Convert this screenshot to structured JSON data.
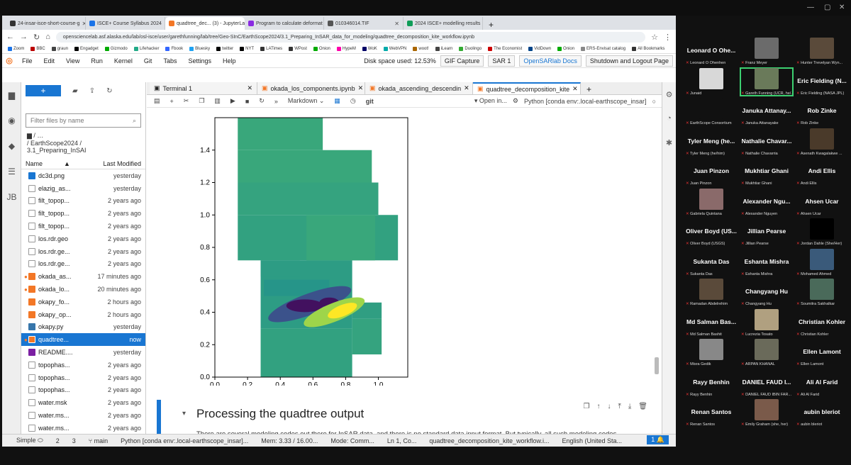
{
  "browser": {
    "tabs": [
      {
        "label": "24-insar-isce-short-course-g",
        "color": "#333"
      },
      {
        "label": "ISCE+ Course Syllabus 2024",
        "color": "#1a73e8"
      },
      {
        "label": "quadtree_dec... (3) - JupyterLab",
        "color": "#f37726",
        "active": true
      },
      {
        "label": "Program to calculate deformat",
        "color": "#8a2be2"
      },
      {
        "label": "010346014.TIF",
        "color": "#555"
      },
      {
        "label": "2024 ISCE+ modelling results",
        "color": "#0f9d58"
      }
    ],
    "url": "opensciencelab.asf.alaska.edu/lab/osl-isce/user/garethfunning/lab/tree/Geo-SInC/EarthScope2024/3.1_Preparing_InSAR_data_for_modeling/quadtree_decomposition_kite_workflow.ipynb",
    "bookmarks": [
      "Zoom",
      "BBC",
      "graun",
      "Engadget",
      "Gizmodo",
      "Lifehacker",
      "Fbook",
      "Bluesky",
      "twitter",
      "NYT",
      "LATimes",
      "WPost",
      "Onion",
      "HypeM",
      "WoK",
      "WebVPN",
      "woot!",
      "iLearn",
      "Duolingo",
      "The Economist",
      "VidDown",
      "Onion",
      "ERS-Envisat catalog",
      "All Bookmarks"
    ]
  },
  "jupyter": {
    "menus": [
      "File",
      "Edit",
      "View",
      "Run",
      "Kernel",
      "Git",
      "Tabs",
      "Settings",
      "Help"
    ],
    "disk_space": "Disk space used: 12.53%",
    "buttons": [
      "GIF Capture",
      "SAR 1",
      "OpenSARlab Docs",
      "Shutdown and Logout Page"
    ],
    "filter_placeholder": "Filter files by name",
    "breadcrumb": "/ EarthScope2024 / 3.1_Preparing_InSAI",
    "col_name": "Name",
    "col_modified": "Last Modified",
    "files": [
      {
        "name": "dc3d.png",
        "mod": "yesterday",
        "color": "#1976d2"
      },
      {
        "name": "elazig_as...",
        "mod": "yesterday",
        "color": "#999"
      },
      {
        "name": "filt_topop...",
        "mod": "2 years ago",
        "color": "#999"
      },
      {
        "name": "filt_topop...",
        "mod": "2 years ago",
        "color": "#999"
      },
      {
        "name": "filt_topop...",
        "mod": "2 years ago",
        "color": "#999"
      },
      {
        "name": "los.rdr.geo",
        "mod": "2 years ago",
        "color": "#999"
      },
      {
        "name": "los.rdr.ge...",
        "mod": "2 years ago",
        "color": "#999"
      },
      {
        "name": "los.rdr.ge...",
        "mod": "2 years ago",
        "color": "#999"
      },
      {
        "name": "okada_as...",
        "mod": "17 minutes ago",
        "color": "#f37726",
        "running": true
      },
      {
        "name": "okada_lo...",
        "mod": "20 minutes ago",
        "color": "#f37726",
        "running": true
      },
      {
        "name": "okapy_fo...",
        "mod": "2 hours ago",
        "color": "#f37726"
      },
      {
        "name": "okapy_op...",
        "mod": "2 hours ago",
        "color": "#f37726"
      },
      {
        "name": "okapy.py",
        "mod": "yesterday",
        "color": "#3776ab"
      },
      {
        "name": "quadtree...",
        "mod": "now",
        "color": "#f37726",
        "running": true,
        "selected": true
      },
      {
        "name": "README....",
        "mod": "yesterday",
        "color": "#7b1fa2"
      },
      {
        "name": "topophas...",
        "mod": "2 years ago",
        "color": "#999"
      },
      {
        "name": "topophas...",
        "mod": "2 years ago",
        "color": "#999"
      },
      {
        "name": "topophas...",
        "mod": "2 years ago",
        "color": "#999"
      },
      {
        "name": "water.msk",
        "mod": "2 years ago",
        "color": "#999"
      },
      {
        "name": "water.ms...",
        "mod": "2 years ago",
        "color": "#999"
      },
      {
        "name": "water.ms...",
        "mod": "2 years ago",
        "color": "#999"
      }
    ],
    "doc_tabs": [
      "Terminal 1",
      "okada_los_components.ipynb",
      "okada_ascending_descendin",
      "quadtree_decomposition_kite"
    ],
    "cell_type": "Markdown",
    "git_label": "git",
    "open_in": "Open in...",
    "kernel": "Python [conda env:.local-earthscope_insar]",
    "heading": "Processing the quadtree output",
    "paragraph": "There are several modeling codes out there for InSAR data, and there is no standard data input format. But typically, all such modeling codes",
    "status": {
      "mode": "Simple",
      "n1": "2",
      "n2": "3",
      "branch": "main",
      "kernel": "Python [conda env:.local-earthscope_insar]...",
      "mem": "Mem: 3.33 / 16.00...",
      "cmode": "Mode: Comm...",
      "pos": "Ln 1, Co...",
      "file": "quadtree_decomposition_kite_workflow.i...",
      "lang": "English (United Sta...",
      "bell": "1"
    }
  },
  "chart_data": {
    "type": "heatmap",
    "x_ticks": [
      "0.0",
      "0.2",
      "0.4",
      "0.6",
      "0.8",
      "1.0"
    ],
    "y_ticks": [
      "0.0",
      "0.2",
      "0.4",
      "0.6",
      "0.8",
      "1.0",
      "1.2",
      "1.4"
    ],
    "xlim": [
      0,
      1.18
    ],
    "ylim": [
      0,
      1.6
    ],
    "colormap": "viridis"
  },
  "participants": [
    {
      "name": "Leonard O Ohe...",
      "label": "Leonard O Ohenhen",
      "video": false
    },
    {
      "name": "",
      "label": "Franz Meyer",
      "video": true,
      "color": "#6b6b6b"
    },
    {
      "name": "",
      "label": "Hunter Trevelyan Wyn...",
      "video": true,
      "color": "#5a4a3a"
    },
    {
      "name": "",
      "label": "Junaid",
      "video": true,
      "color": "#d8d8d8"
    },
    {
      "name": "",
      "label": "Gareth Funning (UCR, he/...",
      "video": true,
      "color": "#6a7a5a",
      "active": true
    },
    {
      "name": "Eric Fielding (N...",
      "label": "Eric Fielding (NASA JPL)",
      "video": false
    },
    {
      "name": "",
      "label": "EarthScope Consortium",
      "video": true,
      "color": "#111"
    },
    {
      "name": "Januka Attanay...",
      "label": "Januka Attanayake",
      "video": false
    },
    {
      "name": "Rob Zinke",
      "label": "Rob Zinke",
      "video": false
    },
    {
      "name": "Tyler Meng (he...",
      "label": "Tyler Meng (he/him)",
      "video": false
    },
    {
      "name": "Nathalie Chavar...",
      "label": "Nathalie Chavarria",
      "video": false
    },
    {
      "name": "",
      "label": "Asenath Kwagalakwe ...",
      "video": true,
      "color": "#4a3a2a"
    },
    {
      "name": "Juan Pinzon",
      "label": "Juan Pinzon",
      "video": false
    },
    {
      "name": "Mukhtiar Ghani",
      "label": "Mukhtiar Ghani",
      "video": false
    },
    {
      "name": "Andi Ellis",
      "label": "Andi Ellis",
      "video": false
    },
    {
      "name": "",
      "label": "Gabriela Quintana",
      "video": true,
      "color": "#8a6a6a"
    },
    {
      "name": "Alexander Ngu...",
      "label": "Alexander Nguyen",
      "video": false
    },
    {
      "name": "Ahsen Ucar",
      "label": "Ahsen Ucar",
      "video": false
    },
    {
      "name": "Oliver Boyd (US...",
      "label": "Oliver Boyd (USGS)",
      "video": false
    },
    {
      "name": "Jillian Pearse",
      "label": "Jillian Pearse",
      "video": false
    },
    {
      "name": "",
      "label": "Jordan Dahle (She/Her)",
      "video": true,
      "color": "#000"
    },
    {
      "name": "Sukanta Das",
      "label": "Sukanta Das",
      "video": false
    },
    {
      "name": "Eshanta Mishra",
      "label": "Eshanta Mishra",
      "video": false
    },
    {
      "name": "",
      "label": "Mohamed Ahmed",
      "video": true,
      "color": "#3a5a7a"
    },
    {
      "name": "",
      "label": "Ramadan Abdelrehim",
      "video": true,
      "color": "#5a4a3a"
    },
    {
      "name": "Changyang Hu",
      "label": "Changyang Hu",
      "video": false
    },
    {
      "name": "",
      "label": "Soumitra Sakhalkar",
      "video": true,
      "color": "#4a6a5a"
    },
    {
      "name": "Md Salman Bas...",
      "label": "Md Salman Bashit",
      "video": false
    },
    {
      "name": "",
      "label": "Lucrezia Tosato",
      "video": true,
      "color": "#b0a080"
    },
    {
      "name": "Christian Kohler",
      "label": "Christian Kohler",
      "video": false
    },
    {
      "name": "",
      "label": "Misra Gedik",
      "video": true,
      "color": "#888"
    },
    {
      "name": "",
      "label": "ARPAN KHANAL",
      "video": true,
      "color": "#6a6a5a"
    },
    {
      "name": "Ellen Lamont",
      "label": "Ellen Lamont",
      "video": false
    },
    {
      "name": "Rayy Benhin",
      "label": "Rayy Benhin",
      "video": false
    },
    {
      "name": "DANIEL FAUD I...",
      "label": "DANIEL FAUD IBIN FAR...",
      "video": false
    },
    {
      "name": "Ali Al Farid",
      "label": "Ali Al Farid",
      "video": false
    },
    {
      "name": "Renan Santos",
      "label": "Renan Santos",
      "video": false
    },
    {
      "name": "",
      "label": "Emily Graham (she, her)",
      "video": true,
      "color": "#7a5a4a"
    },
    {
      "name": "aubin bleriot",
      "label": "aubin bleriot",
      "video": false
    }
  ]
}
